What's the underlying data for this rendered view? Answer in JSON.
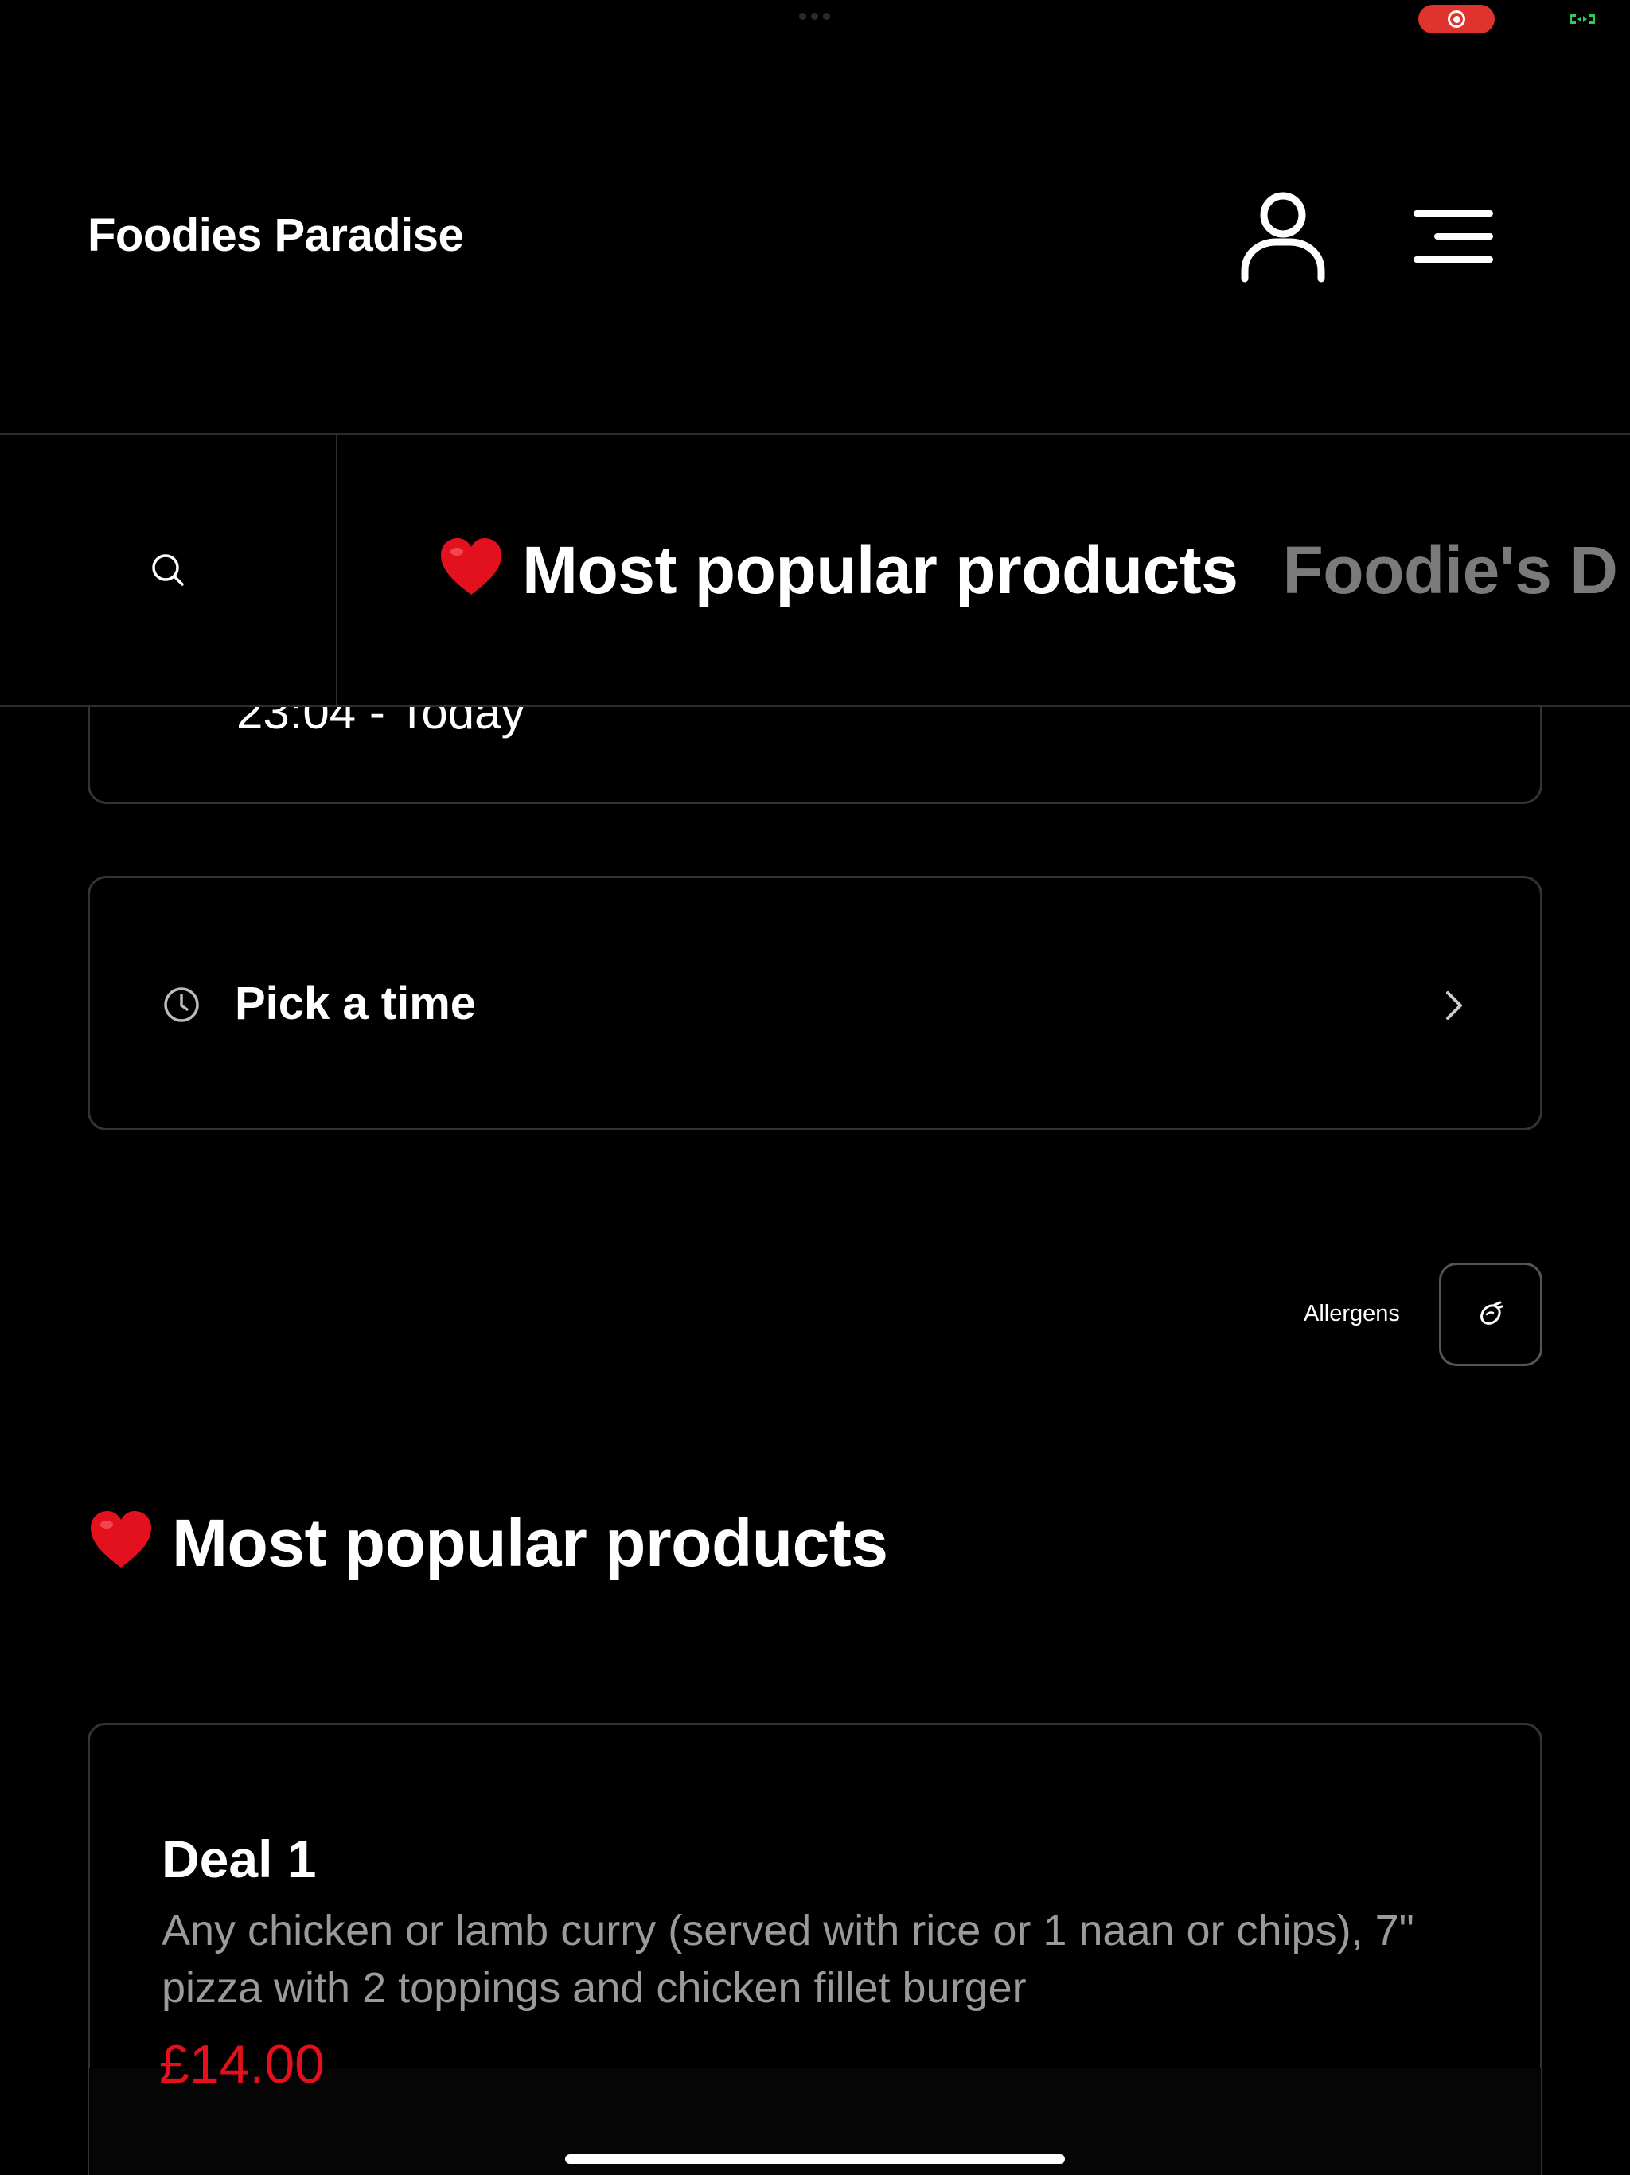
{
  "header": {
    "brand": "Foodies Paradise"
  },
  "category_nav": {
    "tabs": [
      {
        "label": "Most popular products",
        "emoji": "heart",
        "active": true
      },
      {
        "label": "Foodie's D",
        "active": false
      }
    ]
  },
  "collection": {
    "time_text": "23:04 - Today",
    "pick_time_label": "Pick a time"
  },
  "allergens": {
    "label": "Allergens"
  },
  "section": {
    "title": "Most popular products"
  },
  "products": [
    {
      "name": "Deal 1",
      "description": "Any chicken or lamb curry (served with rice or 1 naan or chips), 7\" pizza with 2 toppings and chicken fillet burger",
      "price": "£14.00"
    }
  ],
  "colors": {
    "background": "#000000",
    "price": "#e5101b",
    "border": "#333333",
    "muted_text": "#9a9a9a",
    "inactive_tab": "#7a7a7a"
  }
}
